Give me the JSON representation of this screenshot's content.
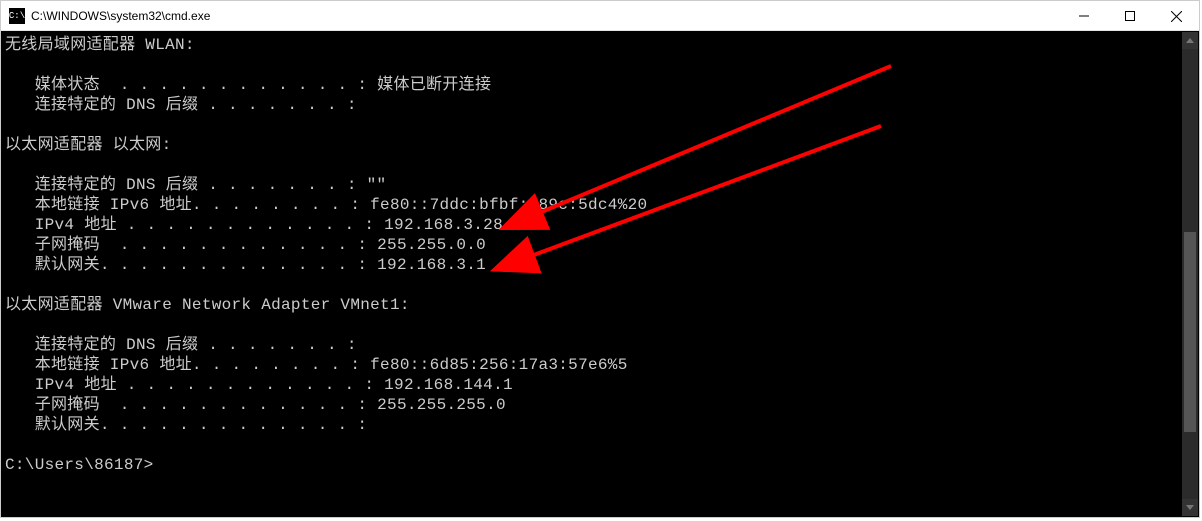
{
  "titlebar": {
    "icon_label": "C:\\",
    "title": "C:\\WINDOWS\\system32\\cmd.exe"
  },
  "terminal": {
    "sections": [
      {
        "header": "无线局域网适配器 WLAN:",
        "rows": [
          {
            "label": "   媒体状态  . . . . . . . . . . . . : ",
            "value": "媒体已断开连接"
          },
          {
            "label": "   连接特定的 DNS 后缀 . . . . . . . :",
            "value": ""
          }
        ]
      },
      {
        "header": "以太网适配器 以太网:",
        "rows": [
          {
            "label": "   连接特定的 DNS 后缀 . . . . . . . : ",
            "value": "\"\""
          },
          {
            "label": "   本地链接 IPv6 地址. . . . . . . . : ",
            "value": "fe80::7ddc:bfbf:989c:5dc4%20"
          },
          {
            "label": "   IPv4 地址 . . . . . . . . . . . . : ",
            "value": "192.168.3.28"
          },
          {
            "label": "   子网掩码  . . . . . . . . . . . . : ",
            "value": "255.255.0.0"
          },
          {
            "label": "   默认网关. . . . . . . . . . . . . : ",
            "value": "192.168.3.1"
          }
        ]
      },
      {
        "header": "以太网适配器 VMware Network Adapter VMnet1:",
        "rows": [
          {
            "label": "   连接特定的 DNS 后缀 . . . . . . . :",
            "value": ""
          },
          {
            "label": "   本地链接 IPv6 地址. . . . . . . . : ",
            "value": "fe80::6d85:256:17a3:57e6%5"
          },
          {
            "label": "   IPv4 地址 . . . . . . . . . . . . : ",
            "value": "192.168.144.1"
          },
          {
            "label": "   子网掩码  . . . . . . . . . . . . : ",
            "value": "255.255.255.0"
          },
          {
            "label": "   默认网关. . . . . . . . . . . . . :",
            "value": ""
          }
        ]
      }
    ],
    "prompt": "C:\\Users\\86187>"
  },
  "annotations": {
    "arrow_color": "#ff0000"
  }
}
